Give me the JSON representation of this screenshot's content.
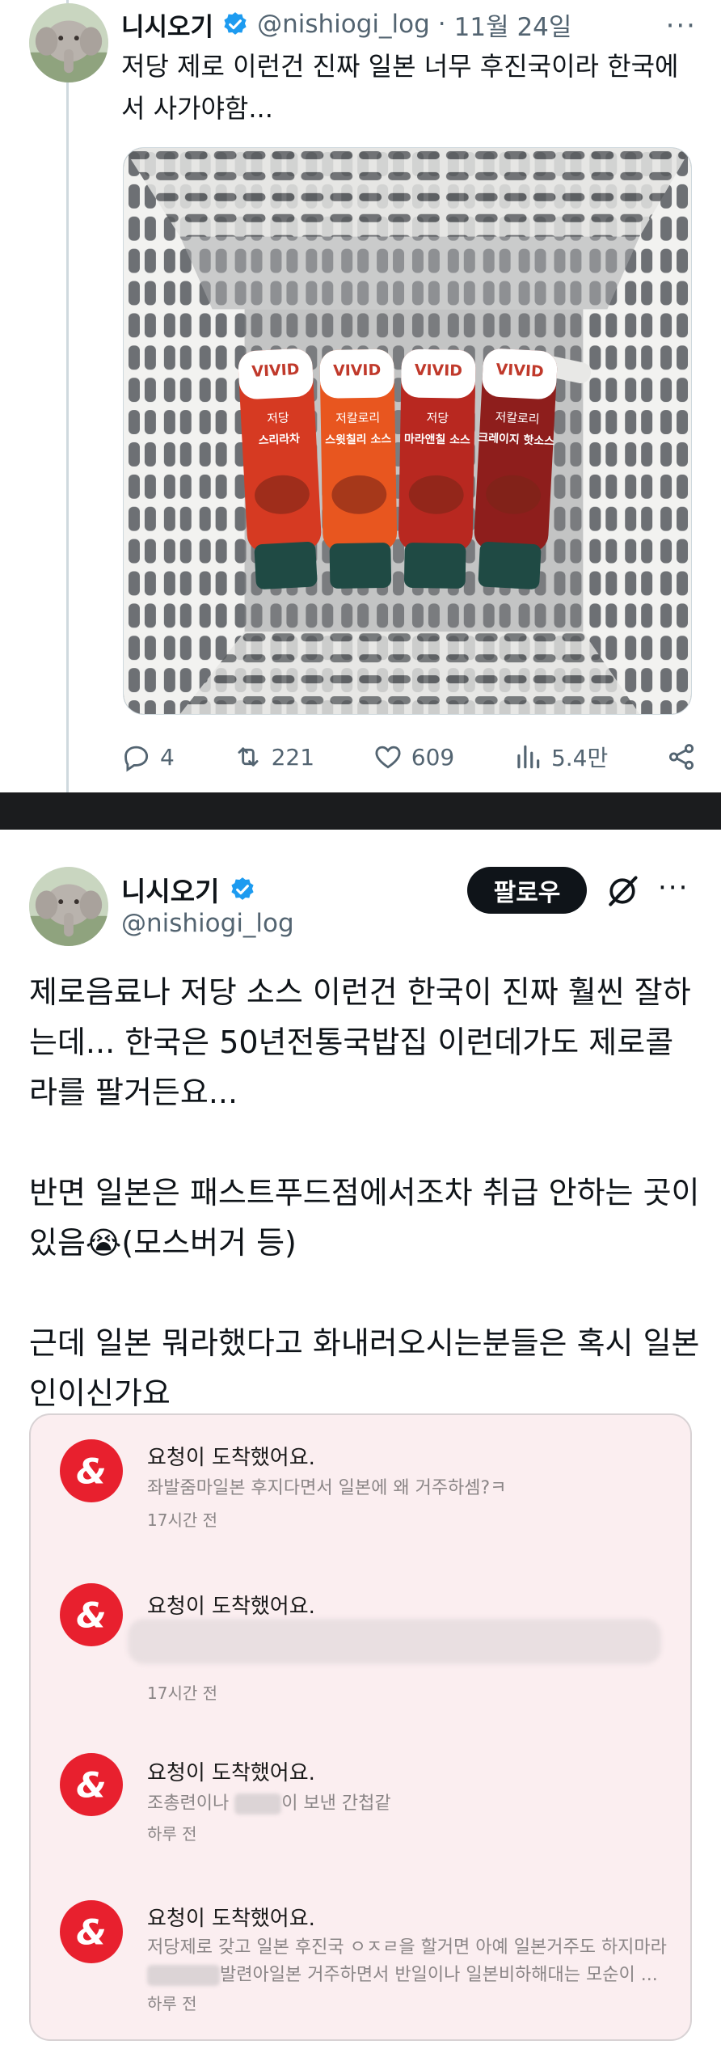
{
  "tweet1": {
    "author_name": "니시오기",
    "handle": "@nishiogi_log",
    "separator": "·",
    "date": "11월 24일",
    "text": "저당 제로 이런건 진짜 일본 너무 후진국이라 한국에서 사가야함...",
    "media": {
      "bottle_brand": "VIVID",
      "bottles": [
        {
          "label_top": "저당",
          "label_main": "스리라차",
          "color": "#d63a22"
        },
        {
          "label_top": "저칼로리",
          "label_main": "스윗칠리 소스",
          "color": "#e8561f"
        },
        {
          "label_top": "저당",
          "label_main": "마라앤칠 소스",
          "color": "#b82820"
        },
        {
          "label_top": "저칼로리",
          "label_main": "크레이지 핫소스",
          "color": "#8e1e1c"
        }
      ]
    },
    "stats": {
      "replies": "4",
      "retweets": "221",
      "likes": "609",
      "views": "5.4만"
    }
  },
  "tweet2": {
    "author_name": "니시오기",
    "handle": "@nishiogi_log",
    "follow_label": "팔로우",
    "paragraphs": [
      "제로음료나 저당 소스 이런건 한국이 진짜 훨씬 잘하는데...  한국은 50년전통국밥집 이런데가도 제로콜라를 팔거든요...",
      "반면 일본은 패스트푸드점에서조차 취급 안하는 곳이 있음😭(모스버거 등)",
      "근데 일본 뭐라했다고 화내러오시는분들은 혹시 일본인이신가요"
    ],
    "notifications": [
      {
        "title": "요청이 도착했어요.",
        "message": "좌발줌마일본 후지다면서 일본에 왜 거주하셈?ㅋ",
        "time": "17시간 전"
      },
      {
        "title": "요청이 도착했어요.",
        "message": "",
        "time": "17시간 전"
      },
      {
        "title": "요청이 도착했어요.",
        "message_prefix": "조총련이나 ",
        "message_suffix": "이 보낸 간첩같",
        "time": "하루 전"
      },
      {
        "title": "요청이 도착했어요.",
        "message_line1": "저당제로 갖고 일본 후진국 ㅇㅈㄹ을 할거면 아예 일본거주도 하지마라",
        "message_line2_suffix": "발련아일본 거주하면서 반일이나 일본비하해대는 모순이 ...",
        "time": "하루 전"
      }
    ]
  },
  "colors": {
    "text": "#0f1419",
    "muted": "#536471",
    "verified": "#1d9bf0",
    "notif_red": "#e8202e",
    "notif_bg": "#fbeef0"
  }
}
